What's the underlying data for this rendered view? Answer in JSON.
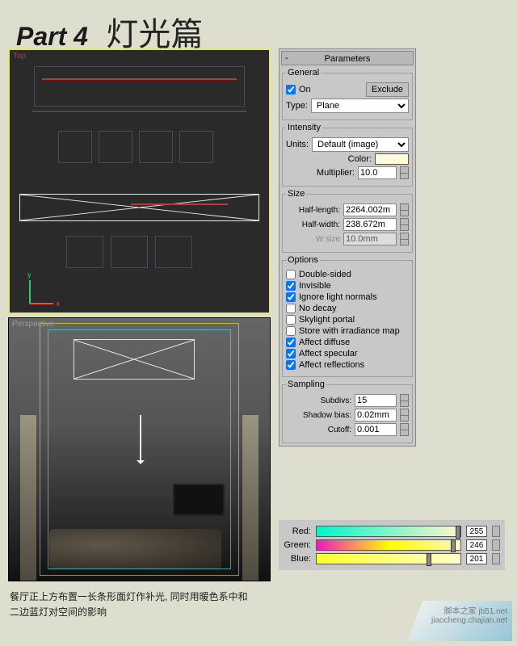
{
  "header": {
    "part": "Part 4",
    "title": "灯光篇"
  },
  "viewports": {
    "top_label": "Top",
    "persp_label": "Perspective",
    "axis_y": "y",
    "axis_x": "x"
  },
  "panel": {
    "title": "Parameters",
    "general": {
      "legend": "General",
      "on": true,
      "on_label": "On",
      "exclude": "Exclude",
      "type_label": "Type:",
      "type_value": "Plane"
    },
    "intensity": {
      "legend": "Intensity",
      "units_label": "Units:",
      "units_value": "Default (image)",
      "color_label": "Color:",
      "color_hex": "#fffad9",
      "multiplier_label": "Multiplier:",
      "multiplier_value": "10.0"
    },
    "size": {
      "legend": "Size",
      "half_length_label": "Half-length:",
      "half_length_value": "2264.002m",
      "half_width_label": "Half-width:",
      "half_width_value": "238.672m",
      "w_size_label": "W size",
      "w_size_value": "10.0mm"
    },
    "options": {
      "legend": "Options",
      "items": [
        {
          "label": "Double-sided",
          "checked": false
        },
        {
          "label": "Invisible",
          "checked": true
        },
        {
          "label": "Ignore light normals",
          "checked": true
        },
        {
          "label": "No decay",
          "checked": false
        },
        {
          "label": "Skylight portal",
          "checked": false
        },
        {
          "label": "Store with irradiance map",
          "checked": false
        },
        {
          "label": "Affect diffuse",
          "checked": true
        },
        {
          "label": "Affect specular",
          "checked": true
        },
        {
          "label": "Affect reflections",
          "checked": true
        }
      ]
    },
    "sampling": {
      "legend": "Sampling",
      "subdivs_label": "Subdivs:",
      "subdivs_value": "15",
      "shadow_bias_label": "Shadow bias:",
      "shadow_bias_value": "0.02mm",
      "cutoff_label": "Cutoff:",
      "cutoff_value": "0.001"
    }
  },
  "color_picker": {
    "channels": [
      {
        "label": "Red:",
        "value": "255"
      },
      {
        "label": "Green:",
        "value": "246"
      },
      {
        "label": "Blue:",
        "value": "201"
      }
    ]
  },
  "caption": {
    "line1": "餐厅正上方布置一长条形面灯作补光, 同时用暖色系中和",
    "line2": "二边蓝灯对空间的影响"
  },
  "watermark": {
    "l1": "脚本之家 jb51.net",
    "l2": "jiaocheng.chajian.net"
  }
}
